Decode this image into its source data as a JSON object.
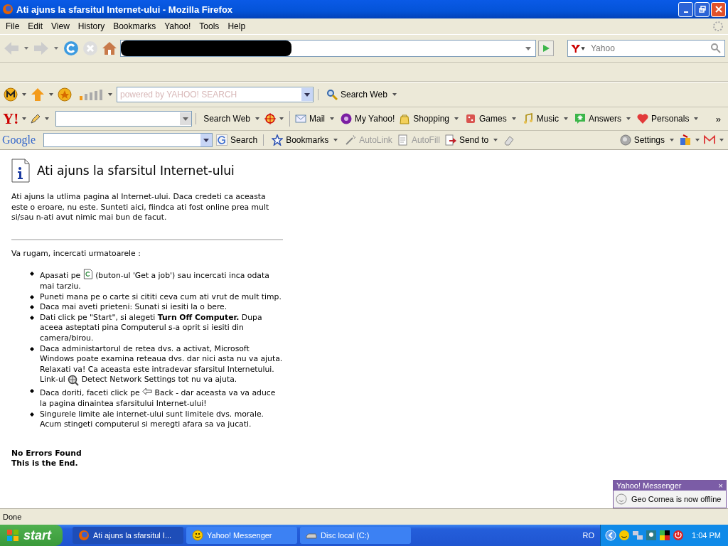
{
  "window": {
    "title": "Ati ajuns la sfarsitul Internet-ului - Mozilla Firefox"
  },
  "menu": [
    "File",
    "Edit",
    "View",
    "History",
    "Bookmarks",
    "Yahoo!",
    "Tools",
    "Help"
  ],
  "search_box": {
    "placeholder": "Yahoo"
  },
  "yahoo_search": {
    "placeholder": "powered by YAHOO! SEARCH",
    "button": "Search Web"
  },
  "yahoo_logo": "Y!",
  "yahoo_toolbar": [
    {
      "label": "Search Web",
      "kind": "search",
      "dropdown": true
    },
    {
      "label": "Mail",
      "kind": "mail",
      "dropdown": true
    },
    {
      "label": "My Yahoo!",
      "kind": "my",
      "dropdown": false
    },
    {
      "label": "Shopping",
      "kind": "bag",
      "dropdown": true
    },
    {
      "label": "Games",
      "kind": "dice",
      "dropdown": true
    },
    {
      "label": "Music",
      "kind": "note",
      "dropdown": true
    },
    {
      "label": "Answers",
      "kind": "answers",
      "dropdown": true
    },
    {
      "label": "Personals",
      "kind": "heart",
      "dropdown": true
    }
  ],
  "yahoo_more": "»",
  "google_toolbar": {
    "logo": "Google",
    "items": [
      {
        "label": "Search",
        "kind": "g",
        "disabled": false
      },
      {
        "label": "Bookmarks",
        "kind": "star",
        "disabled": false
      },
      {
        "label": "AutoLink",
        "kind": "wand",
        "disabled": true
      },
      {
        "label": "AutoFill",
        "kind": "form",
        "disabled": true
      },
      {
        "label": "Send to",
        "kind": "send",
        "disabled": false
      }
    ],
    "settings": "Settings"
  },
  "page": {
    "heading": "Ati ajuns la sfarsitul Internet-ului",
    "intro": "Ati ajuns la utlima pagina al Internet-ului. Daca credeti ca aceasta este o eroare, nu este. Sunteti aici, fiindca ati fost online prea mult si/sau n-ati avut nimic mai bun de facut.",
    "prompt": "Va rugam, incercati urmatoarele :",
    "bullets": [
      {
        "kind": "refresh",
        "text": "Apasati pe",
        "text_after": "(buton-ul 'Get a job') sau incercati inca odata mai tarziu."
      },
      {
        "kind": "plain",
        "text": "Puneti mana pe o carte si cititi ceva cum ati vrut de mult timp."
      },
      {
        "kind": "plain",
        "text": "Daca mai aveti prieteni: Sunati si iesiti la o bere."
      },
      {
        "kind": "plain",
        "text": "Dati click pe \"Start\", si alegeti **Turn Off Computer.** Dupa aceea asteptati pina Computerul s-a oprit si iesiti din camera/birou."
      },
      {
        "kind": "detect",
        "text": "Daca administartorul de retea dvs. a activat, Microsoft Windows poate examina reteaua dvs. dar nici asta nu va ajuta. Relaxati va! Ca aceasta este intradevar sfarsitul Internetului. Link-ul",
        "text_after": "Detect Network Settings tot nu va ajuta."
      },
      {
        "kind": "back",
        "text": "Daca doriti, faceti click pe",
        "text_after": "Back - dar aceasta va va aduce la pagina dinaintea sfarsitului Internet-ului!"
      },
      {
        "kind": "plain",
        "text": "Singurele limite ale internet-ului sunt limitele dvs. morale. Acum stingeti computerul si meregti afara sa va jucati."
      }
    ],
    "footer": [
      "No Errors Found",
      "This is the End."
    ]
  },
  "status_bar": "Done",
  "notification": {
    "title": "Yahoo! Messenger",
    "close": "×",
    "message": "Geo Cornea is now offline"
  },
  "taskbar": {
    "start": "start",
    "tasks": [
      {
        "label": "Ati ajuns la sfarsitul I...",
        "kind": "firefox",
        "selected": true
      },
      {
        "label": "Yahoo! Messenger",
        "kind": "smiley",
        "selected": false
      },
      {
        "label": "Disc local (C:)",
        "kind": "drive",
        "selected": false
      }
    ],
    "language": "RO",
    "clock": "1:04 PM"
  }
}
